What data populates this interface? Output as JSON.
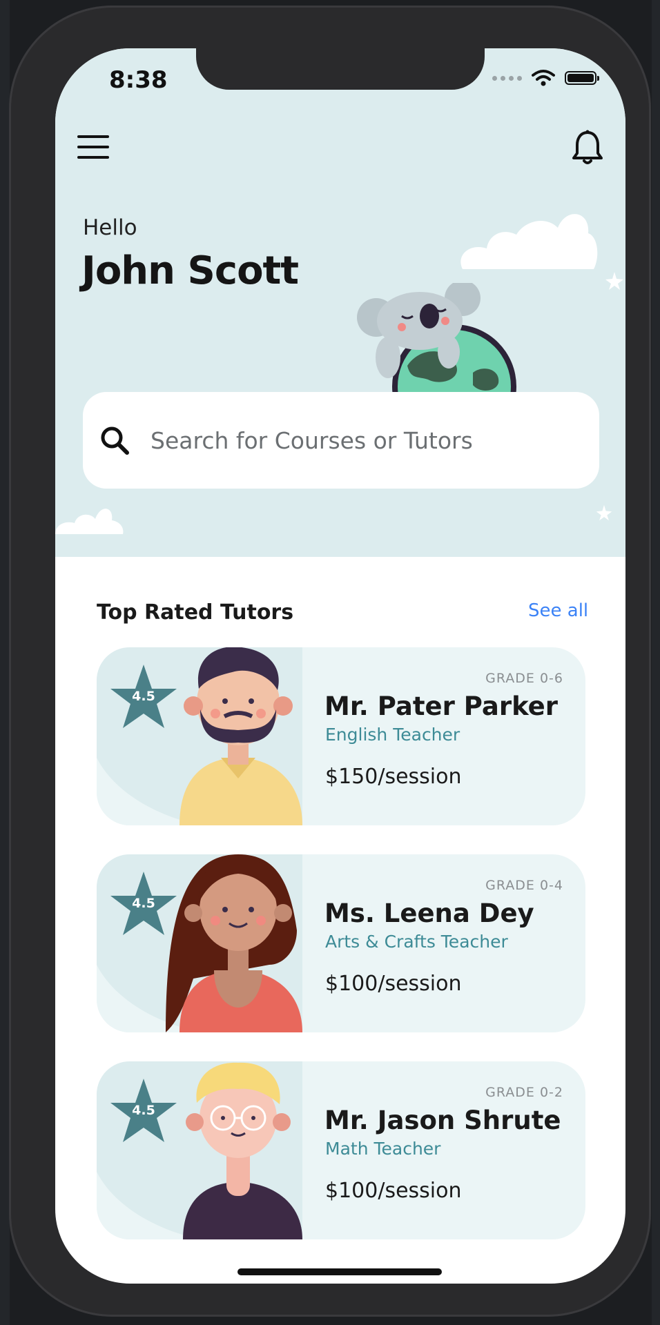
{
  "status_bar": {
    "time": "8:38"
  },
  "header": {
    "greeting": "Hello",
    "user_name": "John Scott"
  },
  "search": {
    "placeholder": "Search for Courses or Tutors"
  },
  "section": {
    "title": "Top Rated Tutors",
    "see_all": "See all"
  },
  "tutors": [
    {
      "grade": "GRADE 0-6",
      "name": "Mr. Pater Parker",
      "role": "English Teacher",
      "price": "$150/session",
      "rating": "4.5"
    },
    {
      "grade": "GRADE 0-4",
      "name": "Ms. Leena Dey",
      "role": "Arts & Crafts Teacher",
      "price": "$100/session",
      "rating": "4.5"
    },
    {
      "grade": "GRADE 0-2",
      "name": "Mr. Jason Shrute",
      "role": "Math Teacher",
      "price": "$100/session",
      "rating": "4.5"
    }
  ],
  "colors": {
    "hero_bg": "#dcecee",
    "card_bg": "#ebf5f6",
    "accent_teal": "#3d8b96",
    "star": "#4a8088",
    "link": "#3b82f6"
  },
  "icons": [
    "hamburger-menu-icon",
    "bell-icon",
    "search-icon",
    "star-icon",
    "wifi-icon",
    "battery-icon"
  ]
}
